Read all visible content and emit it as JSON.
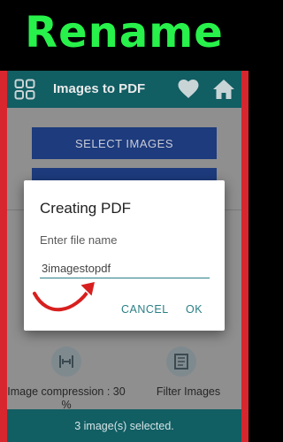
{
  "banner": {
    "text": "Rename"
  },
  "appbar": {
    "title": "Images to PDF",
    "icons": [
      "grid-icon",
      "heart-icon",
      "home-icon"
    ]
  },
  "main": {
    "select_button": "SELECT IMAGES",
    "tools": [
      {
        "label": "Image compression : 30 %",
        "icon": "compress-icon"
      },
      {
        "label": "Filter Images",
        "icon": "filter-icon"
      }
    ]
  },
  "status": {
    "text": "3 image(s) selected."
  },
  "dialog": {
    "title": "Creating PDF",
    "hint": "Enter file name",
    "value": "3imagestopdf",
    "cancel": "CANCEL",
    "ok": "OK"
  },
  "colors": {
    "banner_text": "#27f14a",
    "appbar": "#115e63",
    "button": "#1d3b7d",
    "frame": "#d8262e",
    "accent": "#2a7f86"
  }
}
